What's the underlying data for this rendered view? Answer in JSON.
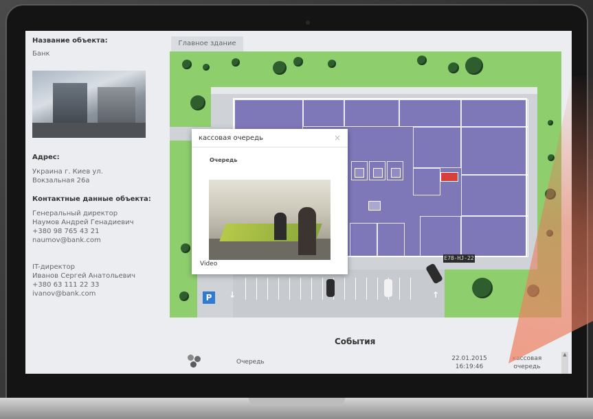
{
  "sidebar": {
    "object_name_title": "Название объекта:",
    "object_name_value": "Банк",
    "address_title": "Адрес:",
    "address_value": "Украина г. Киев ул. Вокзальная 26а",
    "contacts_title": "Контактные данные объекта:",
    "contacts": [
      {
        "role": "Генеральный директор",
        "name": "Наумов Андрей Генадиевич",
        "phone": "+380 98 765 43 21",
        "email": "naumov@bank.com"
      },
      {
        "role": "IT-директор",
        "name": "Иванов Сергей Анатольевич",
        "phone": "+380 63 111 22 33",
        "email": "ivanov@bank.com"
      }
    ]
  },
  "tab": {
    "label": "Главное здание"
  },
  "map": {
    "parking_badge": "P",
    "plate_text": "E78-HJ-22"
  },
  "popup": {
    "title": "кассовая очередь",
    "close_glyph": "×",
    "subtitle": "Очередь",
    "video_label": "Video"
  },
  "events": {
    "title": "События",
    "rows": [
      {
        "type": "Очередь",
        "date": "22.01.2015",
        "time": "16:19:46",
        "place": "кассовая очередь"
      }
    ]
  },
  "colors": {
    "grass": "#8fce6d",
    "building": "#7f78b8",
    "accent_red": "#d6423b",
    "parking_blue": "#2f7bd2"
  }
}
